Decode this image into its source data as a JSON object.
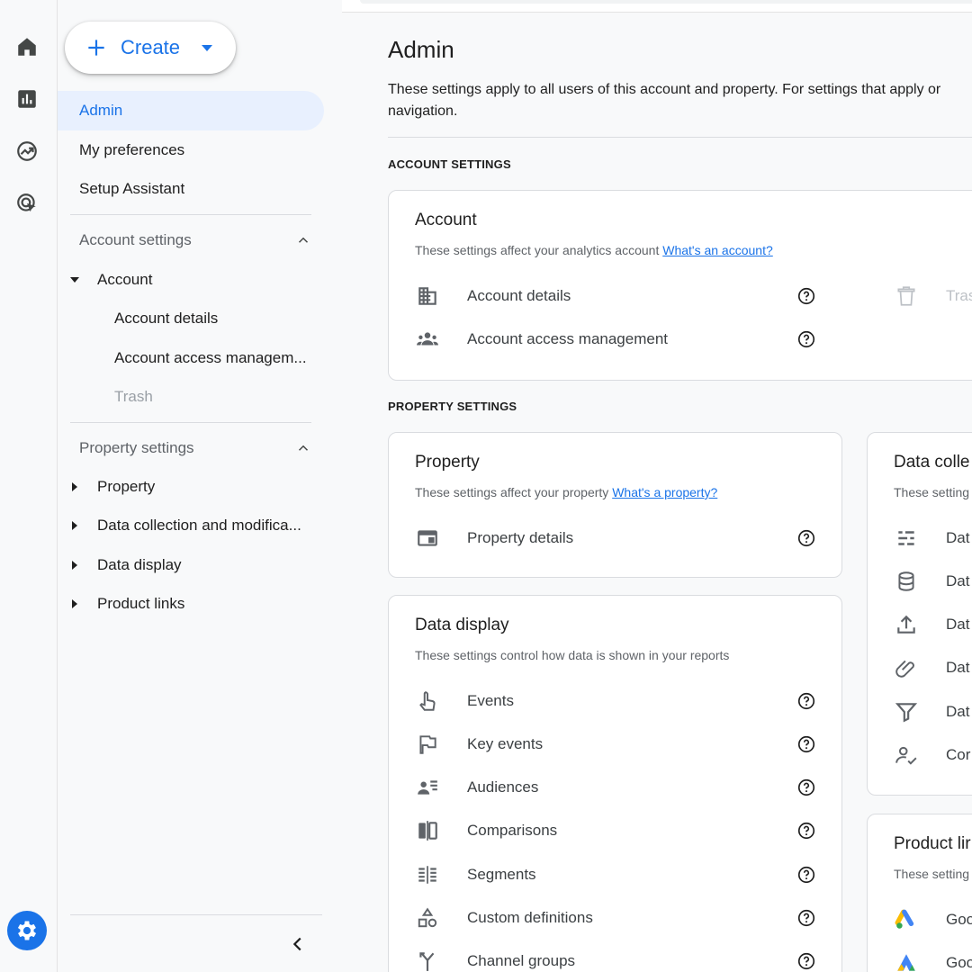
{
  "sidebar": {
    "create_label": "Create",
    "top_items": [
      {
        "label": "Admin"
      },
      {
        "label": "My preferences"
      },
      {
        "label": "Setup Assistant"
      }
    ],
    "account_section": {
      "label": "Account settings",
      "group": "Account",
      "items": [
        "Account details",
        "Account access managem...",
        "Trash"
      ]
    },
    "property_section": {
      "label": "Property settings",
      "items": [
        "Property",
        "Data collection and modifica...",
        "Data display",
        "Product links"
      ]
    }
  },
  "main": {
    "title": "Admin",
    "description": "These settings apply to all users of this account and property. For settings that apply only to you, use the My preferences navigation.",
    "desc_line1": "These settings apply to all users of this account and property. For settings that apply or",
    "desc_line2": "navigation.",
    "account_heading": "ACCOUNT SETTINGS",
    "property_heading": "PROPERTY SETTINGS",
    "account_card": {
      "title": "Account",
      "subtitle": "These settings affect your analytics account",
      "link": "What's an account?",
      "rows": [
        "Account details",
        "Account access management"
      ],
      "trash_partial": "Tras"
    },
    "property_card": {
      "title": "Property",
      "subtitle": "These settings affect your property",
      "link": "What's a property?",
      "rows": [
        "Property details"
      ]
    },
    "data_display_card": {
      "title": "Data display",
      "subtitle": "These settings control how data is shown in your reports",
      "rows": [
        "Events",
        "Key events",
        "Audiences",
        "Comparisons",
        "Segments",
        "Custom definitions",
        "Channel groups"
      ]
    },
    "data_collection_card": {
      "title": "Data colle",
      "subtitle": "These setting",
      "rows": [
        "Dat",
        "Dat",
        "Dat",
        "Dat",
        "Dat",
        "Cor"
      ]
    },
    "product_links_card": {
      "title": "Product lir",
      "subtitle": "These setting",
      "rows": [
        "Goo",
        "Goo"
      ]
    }
  },
  "colors": {
    "accent": "#1a73e8",
    "active_bg": "#e8f0fe",
    "rail_bg": "#f8f9fa"
  }
}
